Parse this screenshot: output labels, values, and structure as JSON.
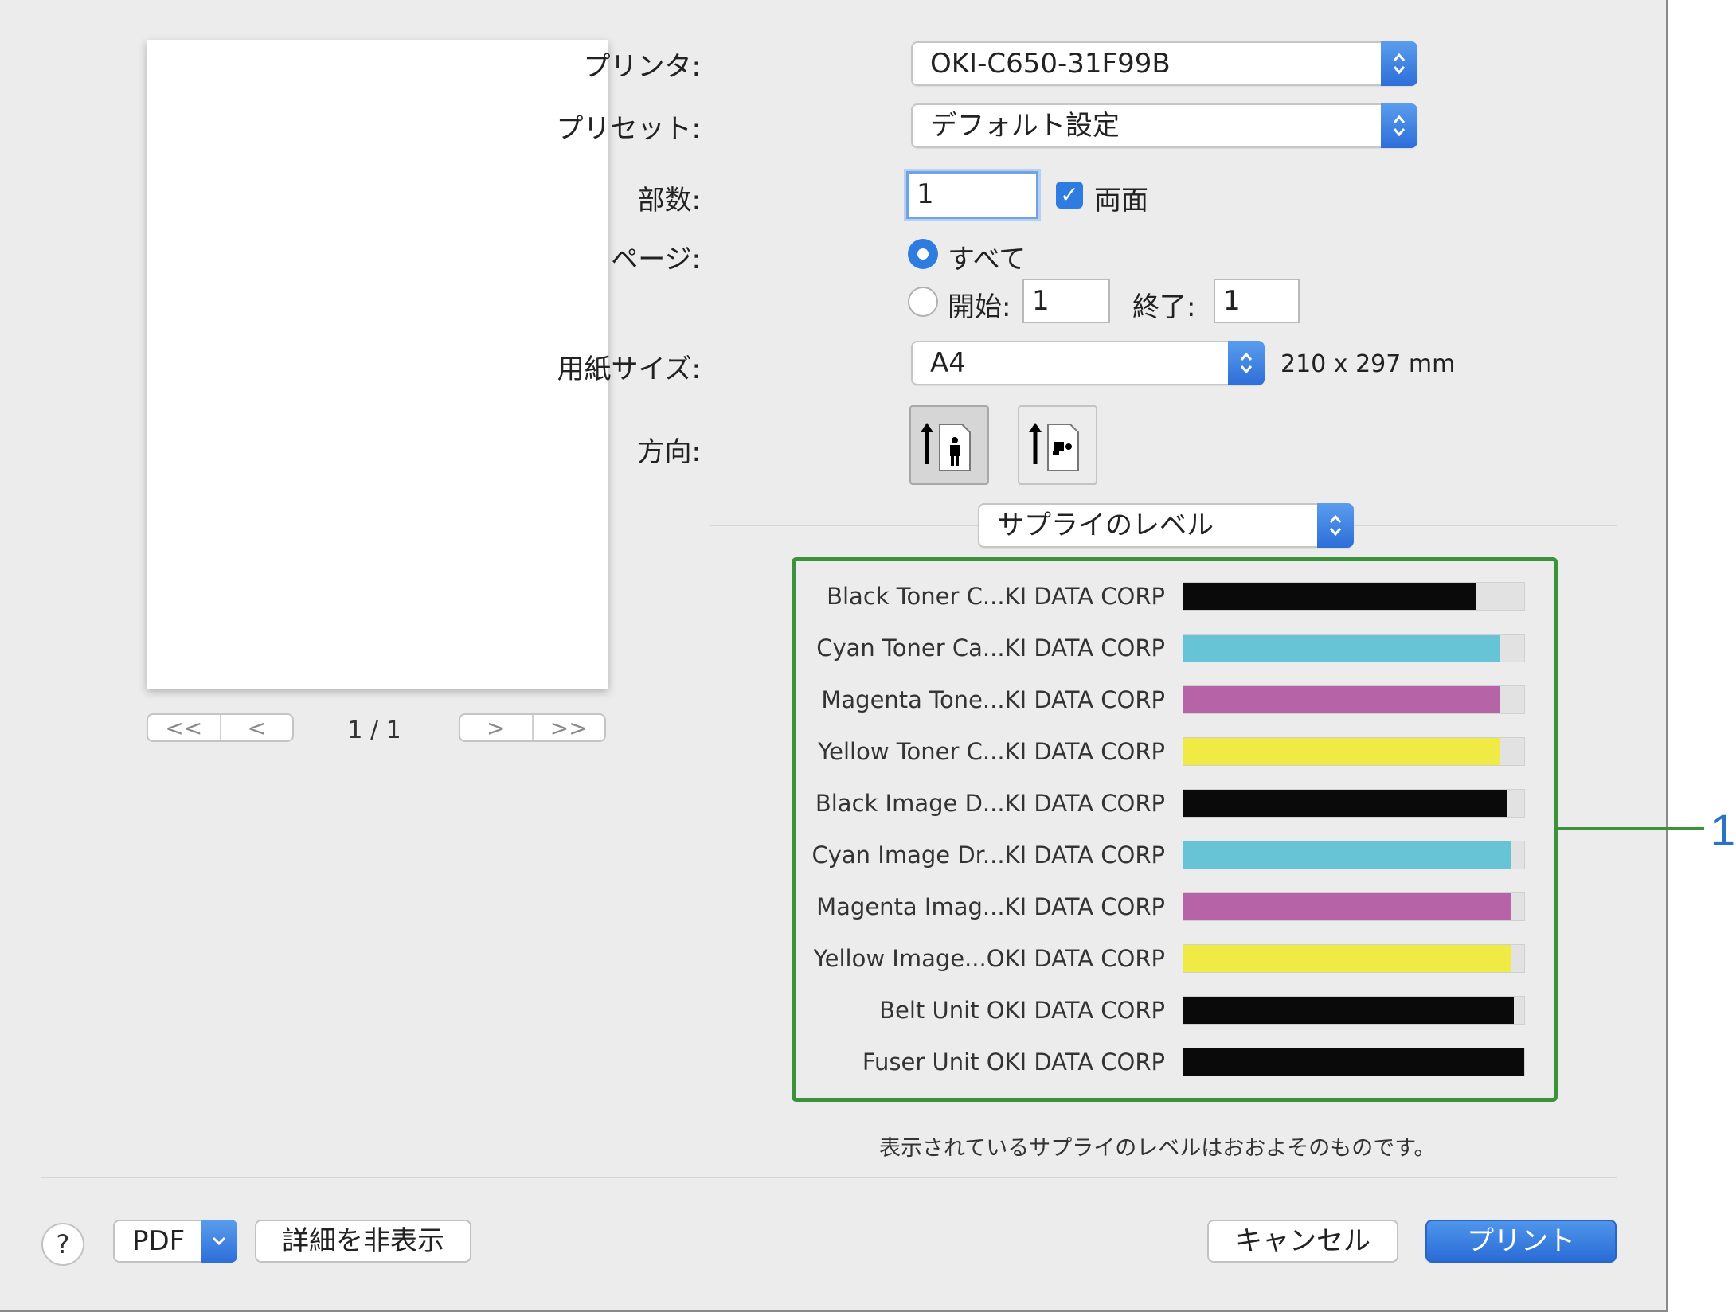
{
  "preview": {
    "page_indicator": "1 / 1",
    "first_icon": "<<",
    "prev_icon": "<",
    "next_icon": ">",
    "last_icon": ">>"
  },
  "printer": {
    "label": "プリンタ:",
    "value": "OKI-C650-31F99B"
  },
  "preset": {
    "label": "プリセット:",
    "value": "デフォルト設定"
  },
  "copies": {
    "label": "部数:",
    "value": "1",
    "duplex_label": "両面",
    "duplex_checked": true
  },
  "pages": {
    "label": "ページ:",
    "all_label": "すべて",
    "all_selected": true,
    "from_label": "開始:",
    "from_value": "1",
    "to_label": "終了:",
    "to_value": "1"
  },
  "paper": {
    "label": "用紙サイズ:",
    "value": "A4",
    "dimensions": "210 x 297 mm"
  },
  "orientation": {
    "label": "方向:",
    "options": [
      "portrait-icon",
      "landscape-icon"
    ],
    "selected": "portrait-icon"
  },
  "section_menu": {
    "value": "サプライのレベル"
  },
  "supplies": [
    {
      "name": "Black Toner C...KI DATA CORP",
      "level": 0.86,
      "color": "#0a0a0a"
    },
    {
      "name": "Cyan Toner Ca...KI DATA CORP",
      "level": 0.93,
      "color": "#66c4d6"
    },
    {
      "name": "Magenta Tone...KI DATA CORP",
      "level": 0.93,
      "color": "#b763a8"
    },
    {
      "name": "Yellow Toner C...KI DATA CORP",
      "level": 0.93,
      "color": "#f0ea45"
    },
    {
      "name": "Black Image D...KI DATA CORP",
      "level": 0.95,
      "color": "#0a0a0a"
    },
    {
      "name": "Cyan Image Dr...KI DATA CORP",
      "level": 0.96,
      "color": "#66c4d6"
    },
    {
      "name": "Magenta Imag...KI DATA CORP",
      "level": 0.96,
      "color": "#b763a8"
    },
    {
      "name": "Yellow Image...OKI DATA CORP",
      "level": 0.96,
      "color": "#f0ea45"
    },
    {
      "name": "Belt Unit OKI DATA CORP",
      "level": 0.97,
      "color": "#0a0a0a"
    },
    {
      "name": "Fuser Unit OKI DATA CORP",
      "level": 1.0,
      "color": "#0a0a0a"
    }
  ],
  "callout": {
    "number": "1",
    "color": "#3a923a"
  },
  "note": "表示されているサプライのレベルはおおよそのものです。",
  "footer": {
    "help_label": "?",
    "pdf_label": "PDF",
    "hide_details_label": "詳細を非表示",
    "cancel_label": "キャンセル",
    "print_label": "プリント"
  }
}
